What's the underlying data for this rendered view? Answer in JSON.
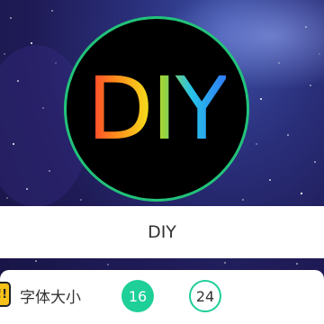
{
  "preview": {
    "text": "DIY"
  },
  "text_input": {
    "value": "DIY"
  },
  "font_size": {
    "icon": "font-size-icon",
    "icon_glyph": "!!",
    "label": "字体大小",
    "options": [
      {
        "value": "16",
        "selected": true
      },
      {
        "value": "24",
        "selected": false
      }
    ]
  },
  "colors": {
    "accent": "#1fcf98",
    "circle_border": "#22c27a",
    "icon_bg": "#f7c21a"
  }
}
